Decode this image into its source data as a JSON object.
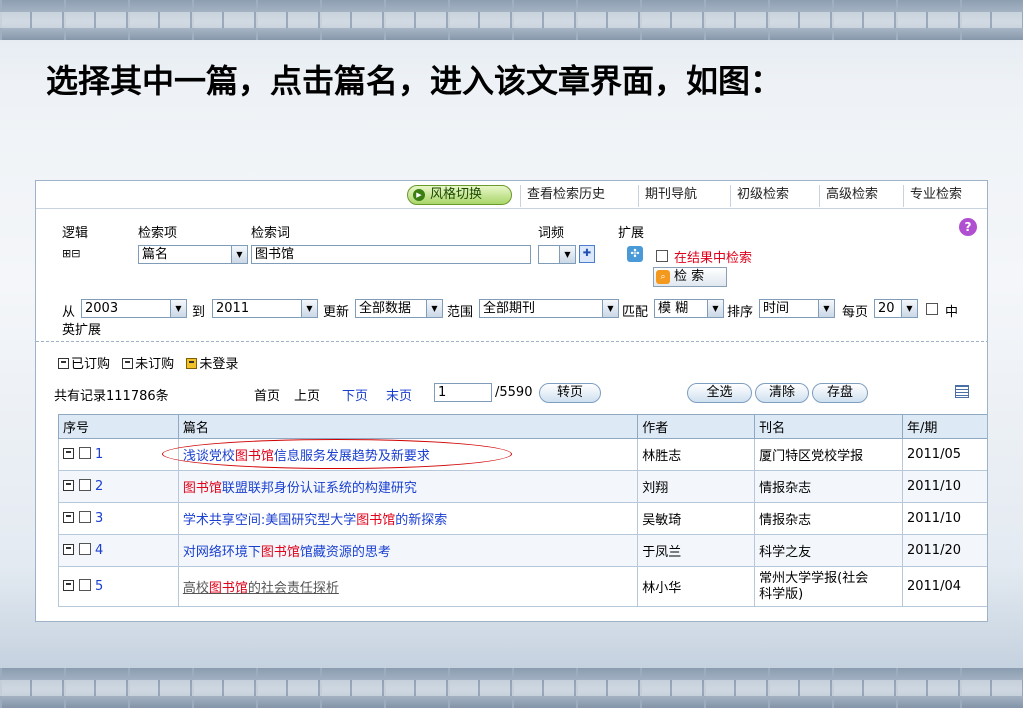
{
  "slide": {
    "title": "选择其中一篇，点击篇名，进入该文章界面，如图："
  },
  "nav": {
    "style_switch": "风格切换",
    "items": [
      "查看检索历史",
      "期刊导航",
      "初级检索",
      "高级检索",
      "专业检索"
    ]
  },
  "form": {
    "logic_label": "逻辑",
    "field_label": "检索项",
    "term_label": "检索词",
    "freq_label": "词频",
    "extend_label": "扩展",
    "field_value": "篇名",
    "term_value": "图书馆",
    "in_results_label": "在结果中检索",
    "search_button": "检 索",
    "from_label": "从",
    "from_value": "2003",
    "to_label": "到",
    "to_value": "2011",
    "update_label": "更新",
    "update_value": "全部数据",
    "range_label": "范围",
    "range_value": "全部期刊",
    "match_label": "匹配",
    "match_value": "模 糊",
    "sort_label": "排序",
    "sort_value": "时间",
    "per_page_label": "每页",
    "per_page_value": "20",
    "cn_en_label_1": "中",
    "cn_en_label_2": "英扩展"
  },
  "legend": {
    "ordered": "已订购",
    "not_ordered": "未订购",
    "not_logged": "未登录"
  },
  "pager": {
    "total": "共有记录111786条",
    "first": "首页",
    "prev": "上页",
    "next": "下页",
    "last": "末页",
    "page_value": "1",
    "page_total": "/5590",
    "goto": "转页",
    "select_all": "全选",
    "clear": "清除",
    "save": "存盘"
  },
  "table": {
    "headers": [
      "序号",
      "篇名",
      "作者",
      "刊名",
      "年/期"
    ],
    "rows": [
      {
        "no": "1",
        "pre": "浅谈党校",
        "hl": "图书馆",
        "post": "信息服务发展趋势及新要求",
        "author": "林胜志",
        "journal": "厦门特区党校学报",
        "journal2": "",
        "issue": "2011/05"
      },
      {
        "no": "2",
        "pre": "",
        "hl": "图书馆",
        "post": "联盟联邦身份认证系统的构建研究",
        "author": "刘翔",
        "journal": "情报杂志",
        "journal2": "",
        "issue": "2011/10"
      },
      {
        "no": "3",
        "pre": "学术共享空间:美国研究型大学",
        "hl": "图书馆",
        "post": "的新探索",
        "author": "吴敏琦",
        "journal": "情报杂志",
        "journal2": "",
        "issue": "2011/10"
      },
      {
        "no": "4",
        "pre": "对网络环境下",
        "hl": "图书馆",
        "post": "馆藏资源的思考",
        "author": "于凤兰",
        "journal": "科学之友",
        "journal2": "",
        "issue": "2011/20"
      },
      {
        "no": "5",
        "pre": "高校",
        "hl": "图书馆",
        "post": "的社会责任探析",
        "author": "林小华",
        "journal": "常州大学学报(社会",
        "journal2": "科学版)",
        "issue": "2011/04"
      }
    ]
  }
}
